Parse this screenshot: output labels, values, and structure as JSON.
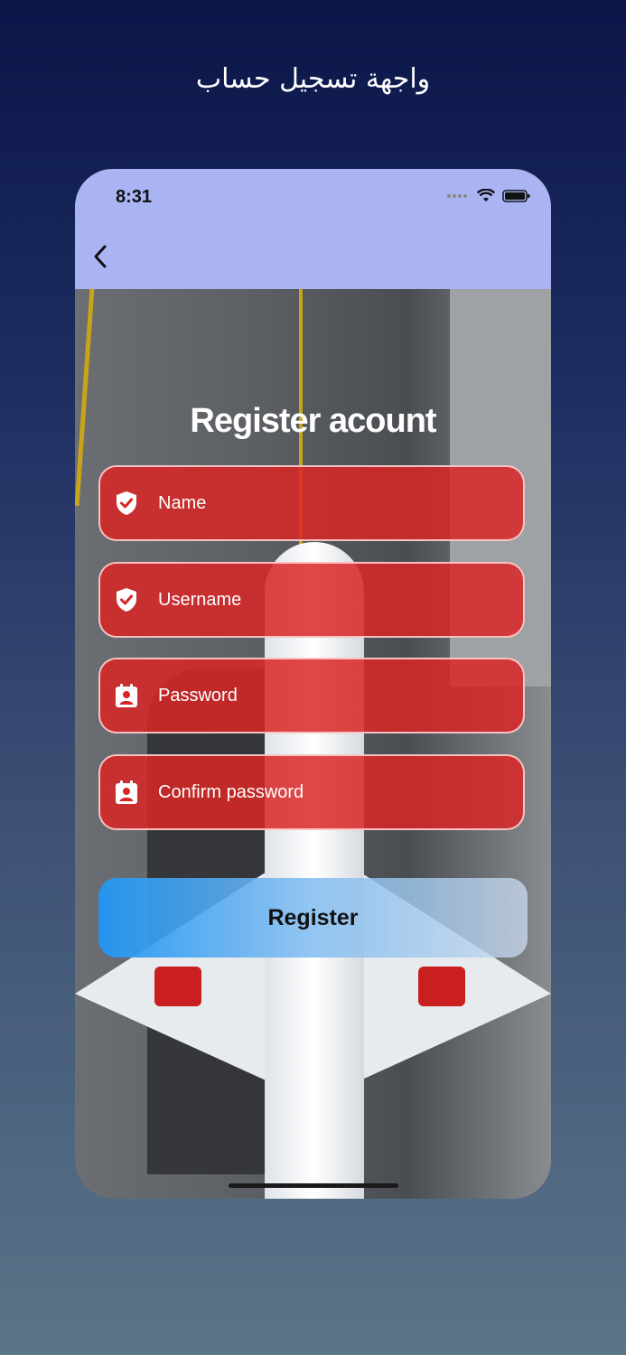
{
  "caption": "واجهة تسجيل حساب",
  "status_bar": {
    "time": "8:31"
  },
  "nav": {
    "back_icon": "chevron-left-icon"
  },
  "form": {
    "title": "Register acount",
    "fields": [
      {
        "label": "Name",
        "icon": "shield-check-icon"
      },
      {
        "label": "Username",
        "icon": "shield-check-icon"
      },
      {
        "label": "Password",
        "icon": "contact-card-icon"
      },
      {
        "label": "Confirm password",
        "icon": "contact-card-icon"
      }
    ],
    "submit_label": "Register"
  },
  "colors": {
    "header": "#aab4f3",
    "field_fill": "#d92626",
    "button_start": "#2196f3"
  }
}
